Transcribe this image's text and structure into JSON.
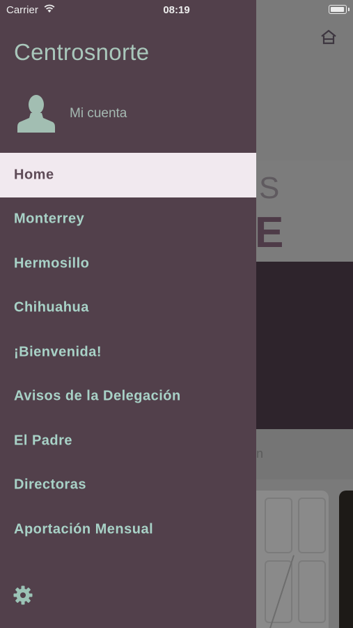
{
  "status_bar": {
    "carrier": "Carrier",
    "time": "08:19"
  },
  "drawer": {
    "app_title": "Centrosnorte",
    "account_label": "Mi cuenta",
    "menu": [
      {
        "label": "Home",
        "active": true
      },
      {
        "label": "Monterrey",
        "active": false
      },
      {
        "label": "Hermosillo",
        "active": false
      },
      {
        "label": "Chihuahua",
        "active": false
      },
      {
        "label": "¡Bienvenida!",
        "active": false
      },
      {
        "label": "Avisos de la Delegación",
        "active": false
      },
      {
        "label": "El Padre",
        "active": false
      },
      {
        "label": "Directoras",
        "active": false
      },
      {
        "label": "Aportación Mensual",
        "active": false
      }
    ]
  },
  "background": {
    "hero_fragment_1": "S",
    "hero_fragment_2": "E",
    "strip_fragment": "n"
  },
  "icons": {
    "home": "home-icon",
    "settings": "gear-icon",
    "avatar": "person-icon",
    "wifi": "wifi-icon",
    "battery": "battery-icon"
  },
  "colors": {
    "drawer_bg": "#52404b",
    "accent_text": "#a8d2c7",
    "active_item_bg": "#f1e9ef",
    "active_item_text": "#5e4b57"
  }
}
